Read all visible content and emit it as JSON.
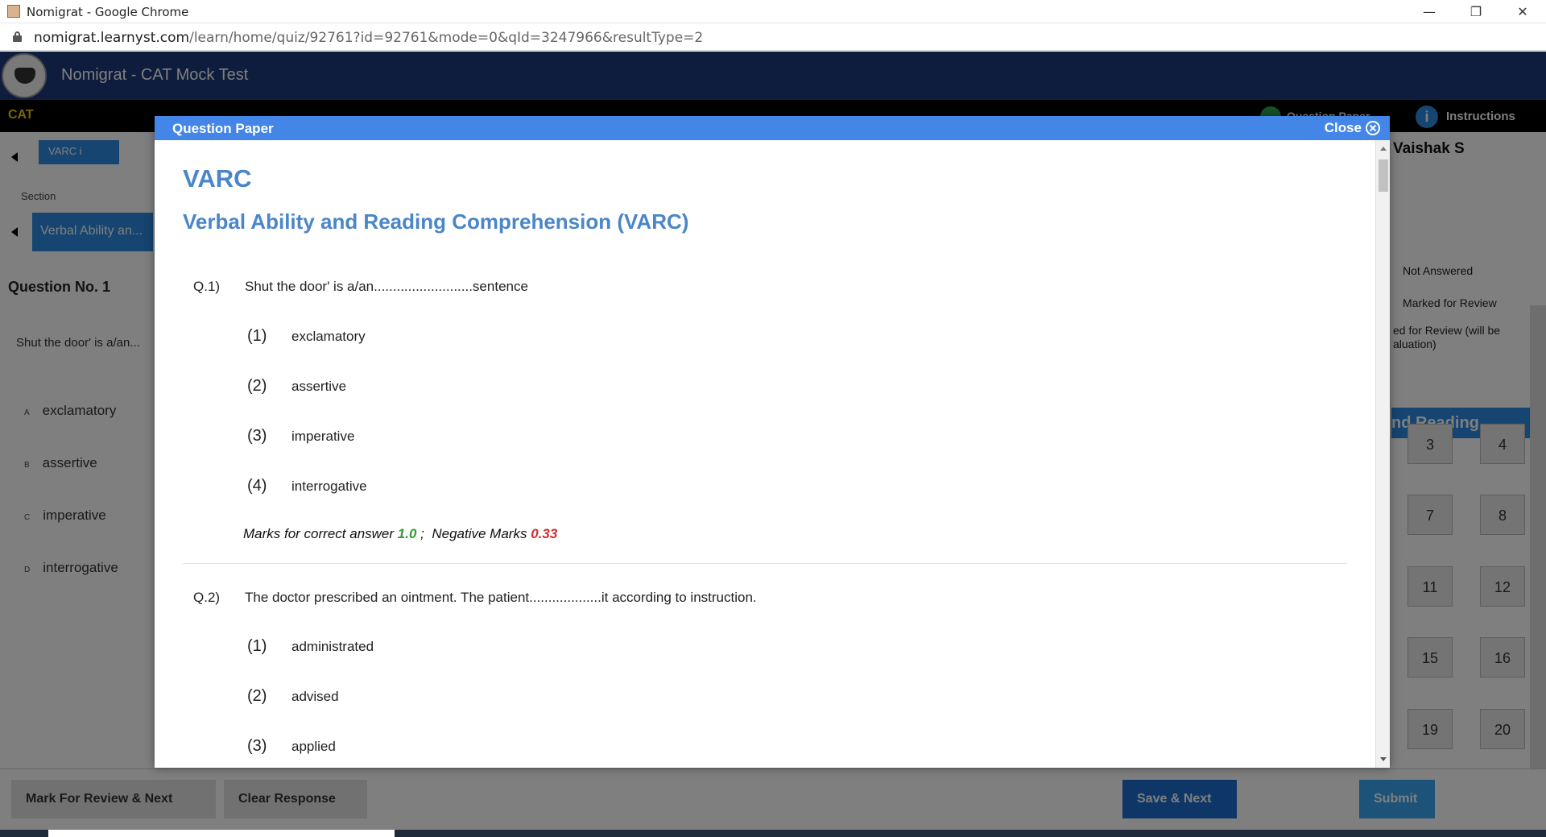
{
  "browser": {
    "window_title": "Nomigrat - Google Chrome",
    "url_domain": "nomigrat.learnyst.com",
    "url_path": "/learn/home/quiz/92761?id=92761&mode=0&qId=3247966&resultType=2",
    "minimize": "—",
    "restore": "❐",
    "close": "✕"
  },
  "app": {
    "title": "Nomigrat - CAT Mock Test",
    "exam": "CAT",
    "question_paper_link": "Question Paper",
    "instructions_link": "Instructions",
    "section_tab": "VARC",
    "section_tab_info": "i",
    "section_label": "Section",
    "section_select": "Verbal Ability an...",
    "question_no": "Question No. 1",
    "question_text": "Shut the door' is a/an...",
    "options": [
      {
        "letter": "A",
        "text": "exclamatory"
      },
      {
        "letter": "B",
        "text": "assertive"
      },
      {
        "letter": "C",
        "text": "imperative"
      },
      {
        "letter": "D",
        "text": "interrogative"
      }
    ],
    "user_name": "Vaishak S",
    "legend": {
      "not_answered": "Not Answered",
      "marked": "Marked for Review",
      "answered_marked": "ed for Review (will be",
      "answered_marked2": "aluation)"
    },
    "palette_header": "nd Reading...",
    "palette_numbers": [
      "3",
      "4",
      "7",
      "8",
      "11",
      "12",
      "15",
      "16",
      "19",
      "20"
    ],
    "buttons": {
      "mark_review": "Mark For Review & Next",
      "clear": "Clear Response",
      "save_next": "Save & Next",
      "submit": "Submit"
    }
  },
  "modal": {
    "title": "Question Paper",
    "close_label": "Close",
    "section_code": "VARC",
    "section_full": "Verbal Ability and Reading Comprehension (VARC)",
    "questions": [
      {
        "num": "Q.1)",
        "text": "Shut the door' is a/an..........................sentence",
        "options": [
          {
            "num": "(1)",
            "text": "exclamatory"
          },
          {
            "num": "(2)",
            "text": "assertive"
          },
          {
            "num": "(3)",
            "text": "imperative"
          },
          {
            "num": "(4)",
            "text": "interrogative"
          }
        ],
        "marks_label": "Marks for correct answer",
        "marks_value": "1.0",
        "sep": ";",
        "neg_label": "Negative Marks",
        "neg_value": "0.33"
      },
      {
        "num": "Q.2)",
        "text": "The doctor prescribed an ointment. The patient...................it according to instruction.",
        "options": [
          {
            "num": "(1)",
            "text": "administrated"
          },
          {
            "num": "(2)",
            "text": "advised"
          },
          {
            "num": "(3)",
            "text": "applied"
          }
        ]
      }
    ]
  }
}
